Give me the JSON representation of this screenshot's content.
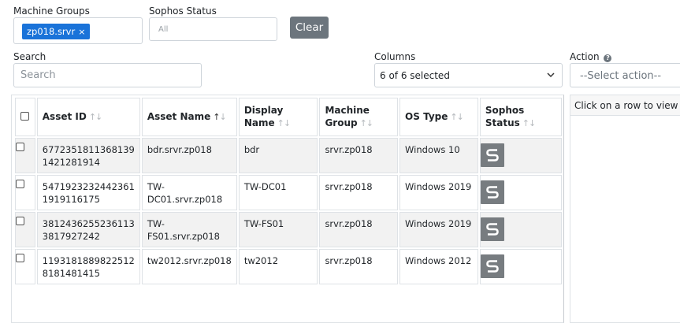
{
  "filters": {
    "machine_groups_label": "Machine Groups",
    "machine_groups_chip": "zp018.srvr",
    "machine_groups_chip_remove": "×",
    "sophos_status_label": "Sophos Status",
    "sophos_status_placeholder": "All",
    "clear_label": "Clear"
  },
  "search": {
    "label": "Search",
    "placeholder": "Search"
  },
  "columns": {
    "label": "Columns",
    "selected_text": "6 of 6 selected"
  },
  "action": {
    "label": "Action",
    "placeholder": "--Select action--"
  },
  "table": {
    "headers": {
      "asset_id": "Asset ID",
      "asset_name": "Asset Name",
      "display_name": "Display Name",
      "machine_group": "Machine Group",
      "os_type": "OS Type",
      "sophos_status": "Sophos Status"
    },
    "sort_icon": "⇅",
    "rows": [
      {
        "asset_id_1": "6772351811368139",
        "asset_id_2": "1421281914",
        "asset_name_1": "bdr.srvr.zp018",
        "asset_name_2": "",
        "display_name": "bdr",
        "machine_group": "srvr.zp018",
        "os_type": "Windows 10"
      },
      {
        "asset_id_1": "5471923232442361",
        "asset_id_2": "1919116175",
        "asset_name_1": "TW-",
        "asset_name_2": "DC01.srvr.zp018",
        "display_name": "TW-DC01",
        "machine_group": "srvr.zp018",
        "os_type": "Windows 2019"
      },
      {
        "asset_id_1": "3812436255236113",
        "asset_id_2": "3817927242",
        "asset_name_1": "TW-",
        "asset_name_2": "FS01.srvr.zp018",
        "display_name": "TW-FS01",
        "machine_group": "srvr.zp018",
        "os_type": "Windows 2019"
      },
      {
        "asset_id_1": "1193181889822512",
        "asset_id_2": "8181481415",
        "asset_name_1": "tw2012.srvr.zp018",
        "asset_name_2": "",
        "display_name": "tw2012",
        "machine_group": "srvr.zp018",
        "os_type": "Windows 2012"
      }
    ],
    "status_icon": "sophos-shield-icon"
  },
  "detail": {
    "text": "Click on a row to view details"
  },
  "colors": {
    "chip": "#1a73d9",
    "clear_button": "#6c757d",
    "sophos_icon": "#777c80",
    "striped_row": "#f2f2f2"
  }
}
